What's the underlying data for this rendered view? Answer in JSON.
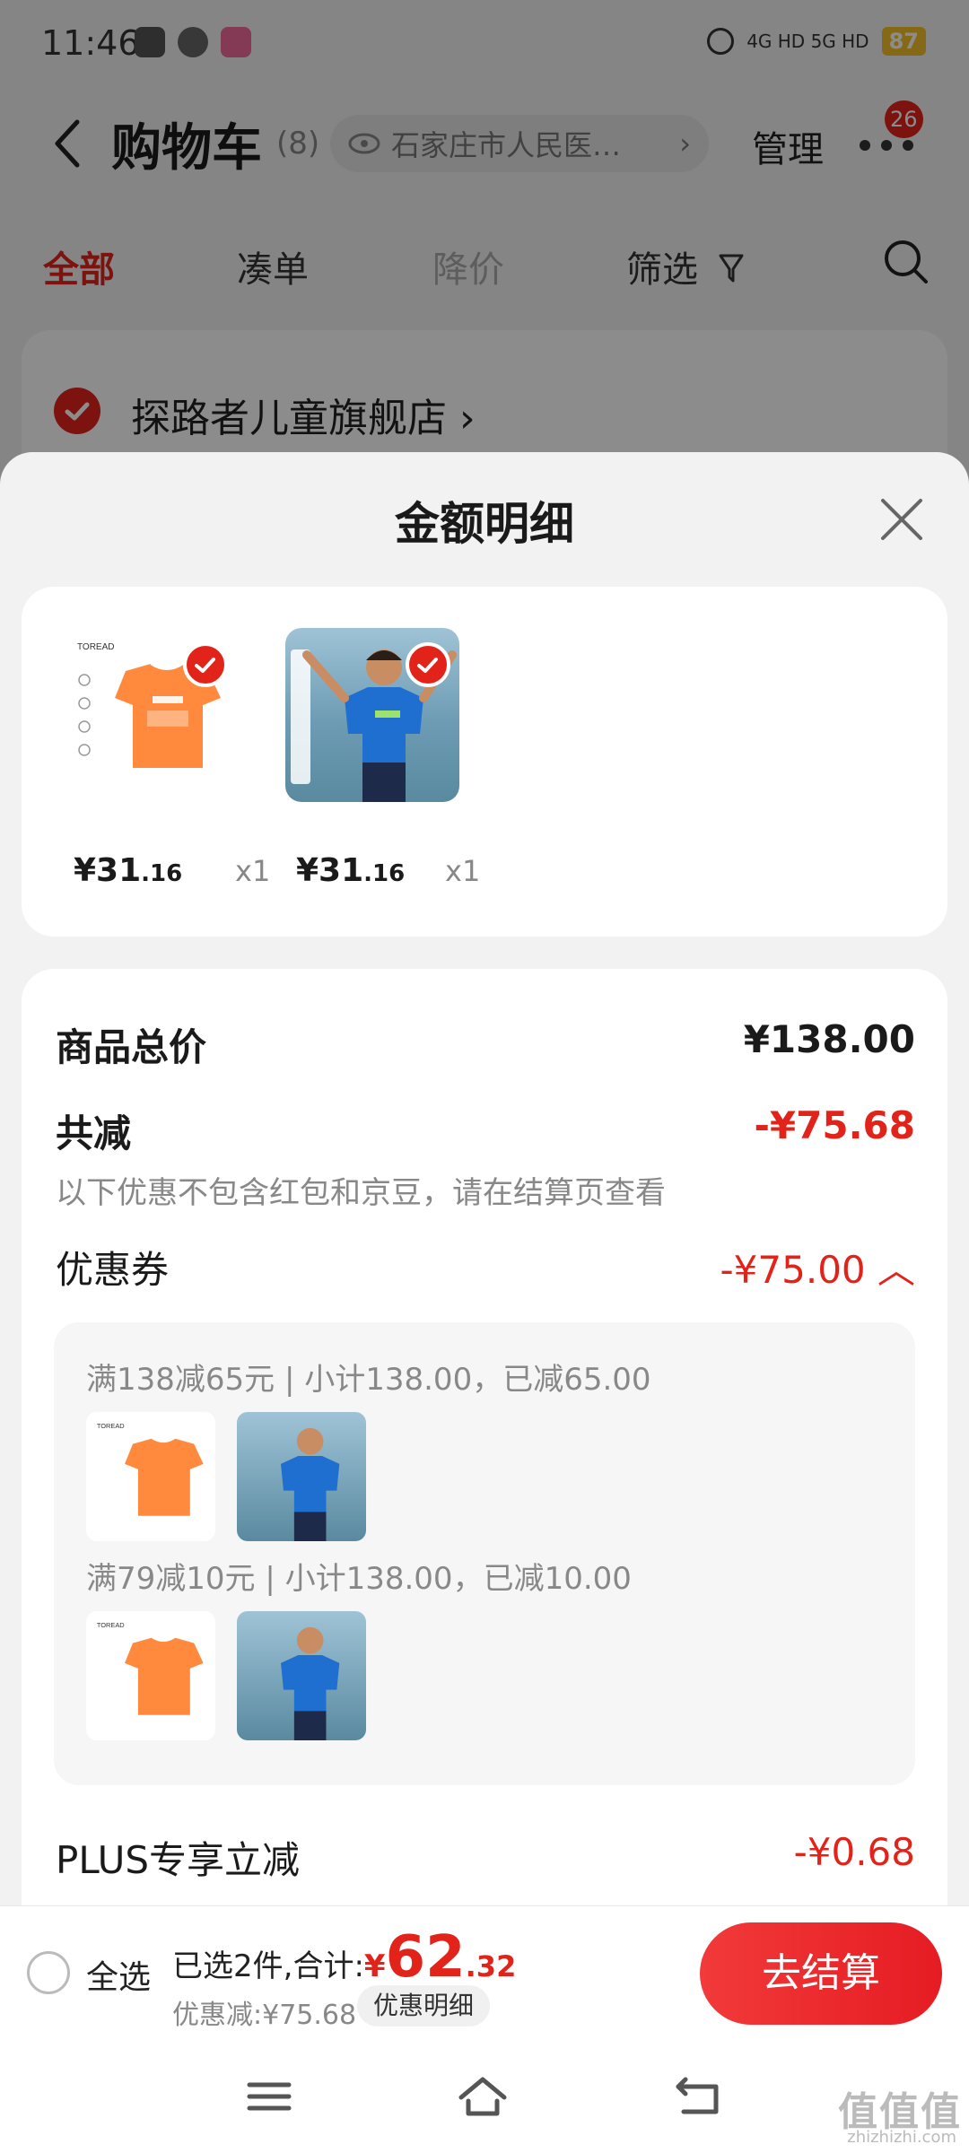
{
  "status_bar": {
    "time": "11:46",
    "network": "4G HD  5G HD",
    "battery": "87"
  },
  "header": {
    "title": "购物车",
    "count": "(8)",
    "address": "石家庄市人民医…",
    "manage_label": "管理",
    "messages_badge": "26"
  },
  "tabs": [
    {
      "label": "全部",
      "state": "active"
    },
    {
      "label": "凑单",
      "state": "normal"
    },
    {
      "label": "降价",
      "state": "dim"
    },
    {
      "label": "筛选",
      "state": "normal"
    }
  ],
  "store": {
    "name": "探路者儿童旗舰店 ›"
  },
  "sheet": {
    "title": "金额明细",
    "items": [
      {
        "price_main": "¥31",
        "price_decimal": ".16",
        "qty": "x1",
        "image": "orange-tshirt"
      },
      {
        "price_main": "¥31",
        "price_decimal": ".16",
        "qty": "x1",
        "image": "boy-blue-tshirt"
      }
    ],
    "total_label": "商品总价",
    "total_value": "¥138.00",
    "reduce_label": "共减",
    "reduce_value": "-¥75.68",
    "reduce_note": "以下优惠不包含红包和京豆，请在结算页查看",
    "coupon_label": "优惠券",
    "coupon_value": "-¥75.00 ︿",
    "coupon_rules": [
      "满138减65元 | 小计138.00，已减65.00",
      "满79减10元 | 小计138.00，已减10.00"
    ],
    "plus_label": "PLUS专享立减",
    "plus_value": "-¥0.68"
  },
  "bottom_bar": {
    "select_all": "全选",
    "summary_prefix": "已选2件,合计:",
    "currency": "¥",
    "total_int": "62",
    "total_dec": ".32",
    "discount": "优惠减:¥75.68",
    "detail_button": "优惠明细",
    "checkout": "去结算"
  },
  "watermark": {
    "text": "值值值",
    "sub": "zhizhizhi.com"
  },
  "colors": {
    "accent": "#e2231a",
    "background": "#f2f2f2"
  }
}
